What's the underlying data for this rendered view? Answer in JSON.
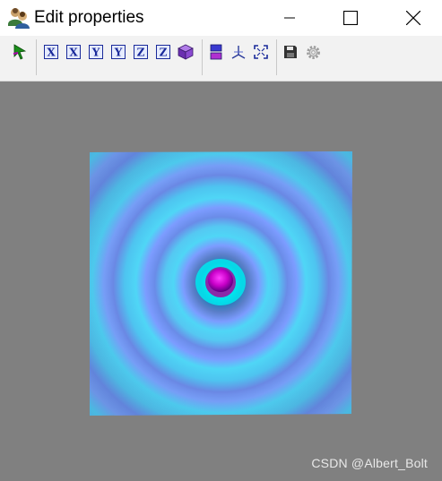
{
  "window": {
    "title": "Edit properties",
    "app_icon": "users-icon",
    "controls": [
      "minimize-icon",
      "maximize-icon",
      "close-icon"
    ]
  },
  "toolbar": {
    "groups": [
      [
        "select-arrow-icon"
      ],
      [
        "rotate-x-neg-icon",
        "rotate-x-pos-icon",
        "rotate-y-neg-icon",
        "rotate-y-pos-icon",
        "rotate-z-neg-icon",
        "rotate-z-pos-icon",
        "cube-icon"
      ],
      [
        "colorbar-icon",
        "axes-icon",
        "fit-view-icon"
      ],
      [
        "save-icon",
        "settings-icon"
      ]
    ],
    "rotate_labels": [
      "X",
      "X",
      "Y",
      "Y",
      "Z",
      "Z"
    ]
  },
  "viewport": {
    "background": "#808080",
    "surface": "concentric ripple surface",
    "colors": {
      "ring_light": "#54d2f5",
      "ring_mid": "#7c9cff",
      "ring_dark": "#5a7ec8",
      "center_cyan": "#00f0f0",
      "peak": "#c800c8"
    }
  },
  "watermark": "CSDN @Albert_Bolt"
}
